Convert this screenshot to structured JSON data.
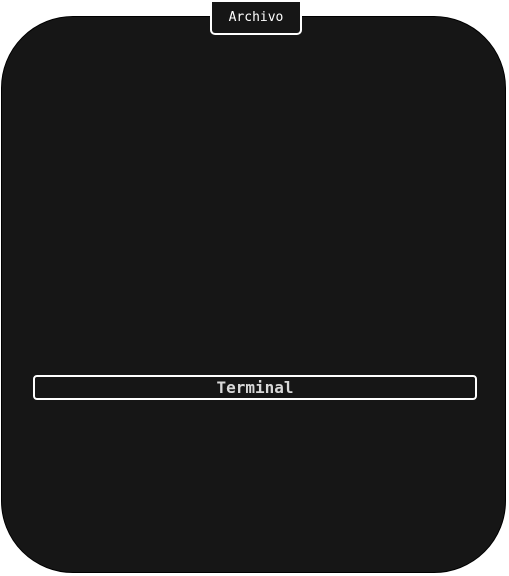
{
  "window": {
    "tab_label": "Archivo"
  },
  "main": {
    "terminal_label": "Terminal"
  },
  "colors": {
    "panel_bg": "#161616",
    "outline": "#ffffff",
    "text": "#ffffff"
  }
}
